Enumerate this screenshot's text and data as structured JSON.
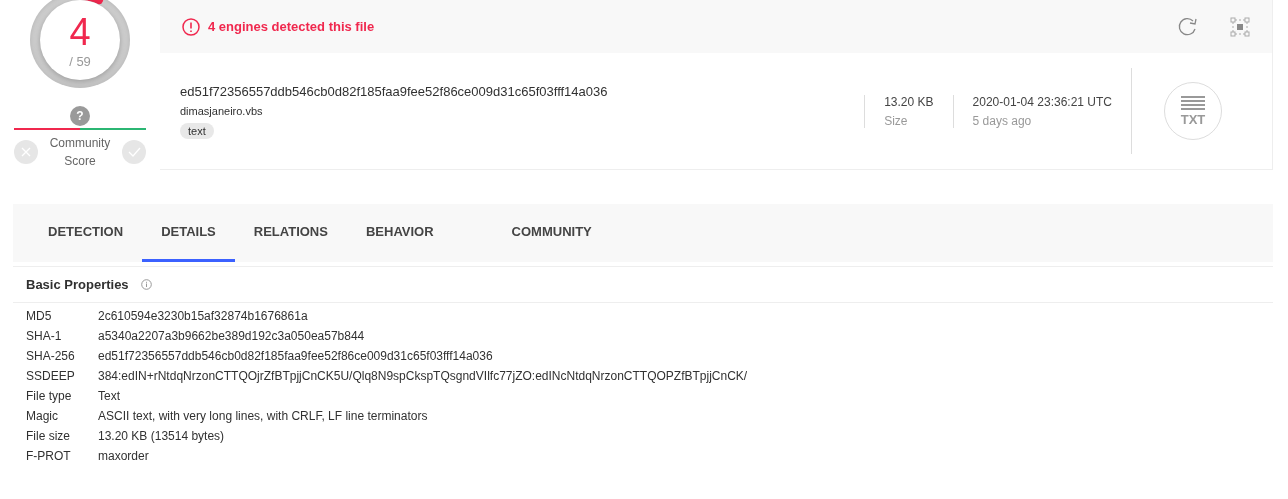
{
  "detection": {
    "count": "4",
    "total": "/ 59",
    "level": 0.068
  },
  "community": {
    "question": "?",
    "label": "Community Score"
  },
  "header": {
    "alert": "4 engines detected this file",
    "hash": "ed51f72356557ddb546cb0d82f185faa9fee52f86ce009d31c65f03fff14a036",
    "filename": "dimasjaneiro.vbs",
    "tags": [
      "text"
    ],
    "stats": [
      {
        "value": "13.20 KB",
        "label": "Size"
      },
      {
        "value": "2020-01-04 23:36:21 UTC",
        "label": "5 days ago"
      }
    ],
    "file_type_badge": "TXT"
  },
  "tabs": [
    {
      "label": "DETECTION",
      "selected": false
    },
    {
      "label": "DETAILS",
      "selected": true
    },
    {
      "label": "RELATIONS",
      "selected": false
    },
    {
      "label": "BEHAVIOR",
      "selected": false
    },
    {
      "label": "COMMUNITY",
      "selected": false
    }
  ],
  "section": {
    "title": "Basic Properties",
    "rows": [
      {
        "key": "MD5",
        "value": "2c610594e3230b15af32874b1676861a"
      },
      {
        "key": "SHA-1",
        "value": "a5340a2207a3b9662be389d192c3a050ea57b844"
      },
      {
        "key": "SHA-256",
        "value": "ed51f72356557ddb546cb0d82f185faa9fee52f86ce009d31c65f03fff14a036"
      },
      {
        "key": "SSDEEP",
        "value": "384:edIN+rNtdqNrzonCTTQOjrZfBTpjjCnCK5U/Qlq8N9spCkspTQsgndVIlfc77jZO:edINcNtdqNrzonCTTQOPZfBTpjjCnCK/"
      },
      {
        "key": "File type",
        "value": "Text"
      },
      {
        "key": "Magic",
        "value": "ASCII text, with very long lines, with CRLF, LF line terminators"
      },
      {
        "key": "File size",
        "value": "13.20 KB (13514 bytes)"
      },
      {
        "key": "F-PROT",
        "value": "maxorder"
      }
    ]
  }
}
